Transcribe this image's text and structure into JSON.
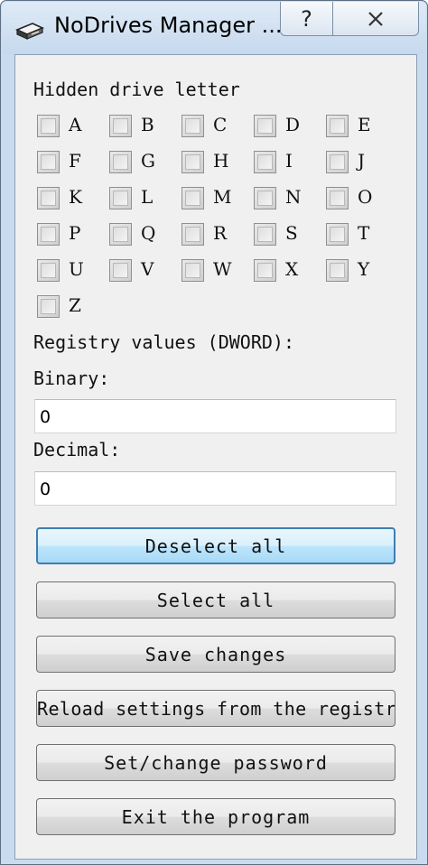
{
  "window": {
    "title": "NoDrives Manager ...",
    "help_glyph": "?",
    "close_glyph": "✕"
  },
  "labels": {
    "hidden_drive": "Hidden drive letter",
    "registry_values": "Registry values (DWORD):",
    "binary": "Binary:",
    "decimal": "Decimal:"
  },
  "drives": [
    "A",
    "B",
    "C",
    "D",
    "E",
    "F",
    "G",
    "H",
    "I",
    "J",
    "K",
    "L",
    "M",
    "N",
    "O",
    "P",
    "Q",
    "R",
    "S",
    "T",
    "U",
    "V",
    "W",
    "X",
    "Y",
    "Z"
  ],
  "fields": {
    "binary_value": "0",
    "decimal_value": "0"
  },
  "buttons": {
    "deselect_all": "Deselect all",
    "select_all": "Select all",
    "save_changes": "Save changes",
    "reload": "Reload settings from the registry",
    "password": "Set/change password",
    "exit": "Exit the program"
  },
  "icons": {
    "app": "drive-icon",
    "help": "help-icon",
    "close": "close-icon"
  }
}
